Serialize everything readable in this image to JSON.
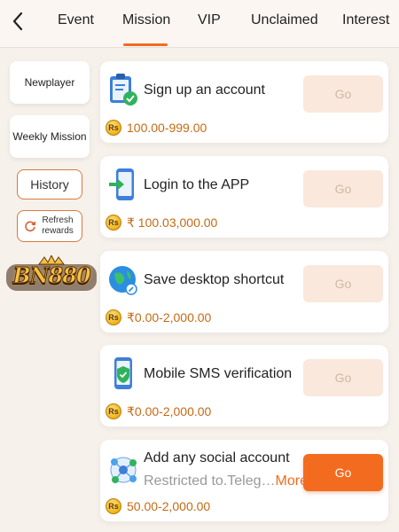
{
  "nav": {
    "back_icon": "chevron-left-icon",
    "tabs": [
      "Event",
      "Mission",
      "VIP",
      "Unclaimed",
      "Interest"
    ],
    "active_tab": "Mission",
    "accent": "#f36b1f"
  },
  "sidebar": {
    "newplayer": "Newplayer",
    "weekly": "Weekly Mission",
    "history": "History",
    "refresh": "Refresh rewards",
    "refresh_icon": "refresh-icon",
    "brand": "BN880"
  },
  "missions": [
    {
      "title": "Sign up an account",
      "reward": "100.00-999.00",
      "button": "Go",
      "icon": "clipboard-check-icon",
      "active": false
    },
    {
      "title": "Login to the APP",
      "reward": "₹ 100.03,000.00",
      "button": "Go",
      "icon": "phone-login-icon",
      "active": false
    },
    {
      "title": "Save desktop shortcut",
      "reward": "₹0.00-2,000.00",
      "button": "Go",
      "icon": "globe-shortcut-icon",
      "active": false
    },
    {
      "title": "Mobile SMS verification",
      "reward": "₹0.00-2,000.00",
      "button": "Go",
      "icon": "phone-shield-icon",
      "active": false
    },
    {
      "title": "Add any social account",
      "desc": "Restricted to.Teleg…",
      "more": "More",
      "reward": "50.00-2,000.00",
      "button": "Go",
      "icon": "social-network-icon",
      "active": true
    }
  ],
  "coin_label": "Rs"
}
